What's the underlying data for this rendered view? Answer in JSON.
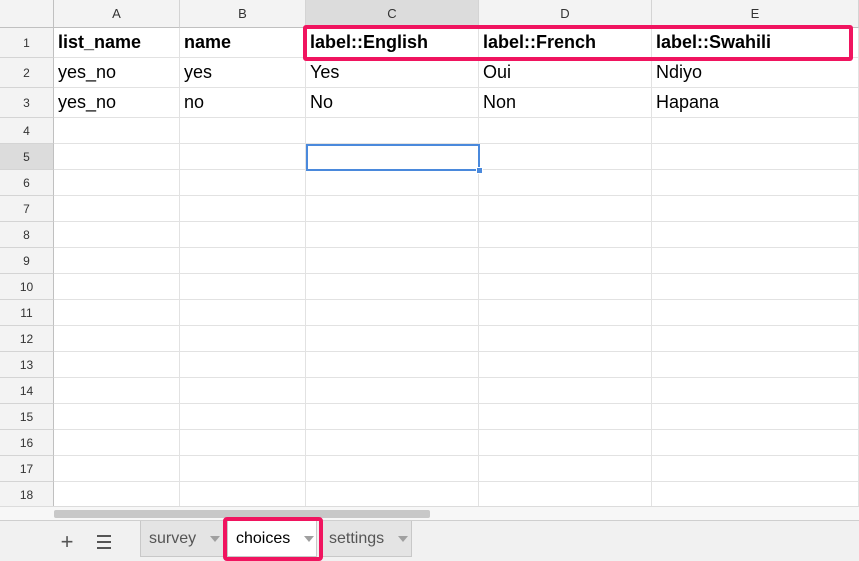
{
  "spreadsheet": {
    "columns": [
      "A",
      "B",
      "C",
      "D",
      "E"
    ],
    "selected_column": "C",
    "selected_row": "5",
    "rows": [
      {
        "num": "1",
        "cells": [
          "list_name",
          "name",
          "label::English",
          "label::French",
          "label::Swahili"
        ]
      },
      {
        "num": "2",
        "cells": [
          "yes_no",
          "yes",
          "Yes",
          "Oui",
          "Ndiyo"
        ]
      },
      {
        "num": "3",
        "cells": [
          "yes_no",
          "no",
          "No",
          "Non",
          "Hapana"
        ]
      },
      {
        "num": "4",
        "cells": [
          "",
          "",
          "",
          "",
          ""
        ]
      },
      {
        "num": "5",
        "cells": [
          "",
          "",
          "",
          "",
          ""
        ]
      },
      {
        "num": "6",
        "cells": [
          "",
          "",
          "",
          "",
          ""
        ]
      },
      {
        "num": "7",
        "cells": [
          "",
          "",
          "",
          "",
          ""
        ]
      },
      {
        "num": "8",
        "cells": [
          "",
          "",
          "",
          "",
          ""
        ]
      },
      {
        "num": "9",
        "cells": [
          "",
          "",
          "",
          "",
          ""
        ]
      },
      {
        "num": "10",
        "cells": [
          "",
          "",
          "",
          "",
          ""
        ]
      },
      {
        "num": "11",
        "cells": [
          "",
          "",
          "",
          "",
          ""
        ]
      },
      {
        "num": "12",
        "cells": [
          "",
          "",
          "",
          "",
          ""
        ]
      },
      {
        "num": "13",
        "cells": [
          "",
          "",
          "",
          "",
          ""
        ]
      },
      {
        "num": "14",
        "cells": [
          "",
          "",
          "",
          "",
          ""
        ]
      },
      {
        "num": "15",
        "cells": [
          "",
          "",
          "",
          "",
          ""
        ]
      },
      {
        "num": "16",
        "cells": [
          "",
          "",
          "",
          "",
          ""
        ]
      },
      {
        "num": "17",
        "cells": [
          "",
          "",
          "",
          "",
          ""
        ]
      },
      {
        "num": "18",
        "cells": [
          "",
          "",
          "",
          "",
          ""
        ]
      }
    ]
  },
  "sheet_tabs": [
    {
      "label": "survey",
      "active": false
    },
    {
      "label": "choices",
      "active": true
    },
    {
      "label": "settings",
      "active": false
    }
  ],
  "toolbar": {
    "add_sheet_icon": "plus-icon",
    "all_sheets_icon": "menu-lines-icon"
  },
  "colors": {
    "highlight": "#f0145f",
    "selection": "#4a89dc"
  }
}
